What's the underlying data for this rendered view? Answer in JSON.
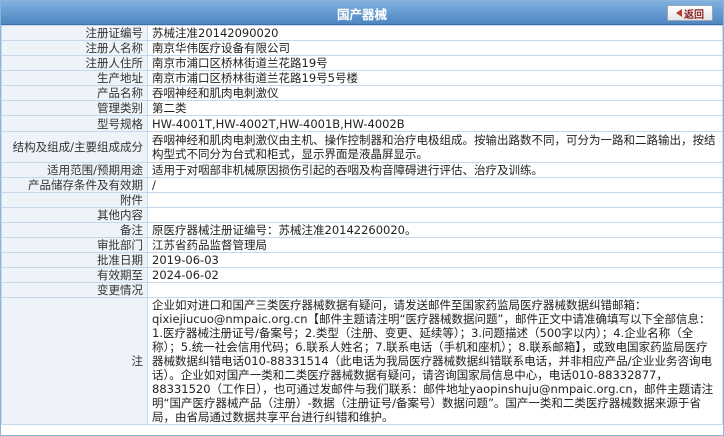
{
  "header": {
    "title": "国产器械",
    "back_label": "返回"
  },
  "rows": [
    {
      "label": "注册证编号",
      "value": "苏械注准20142090020"
    },
    {
      "label": "注册人名称",
      "value": "南京华伟医疗设备有限公司"
    },
    {
      "label": "注册人住所",
      "value": "南京市浦口区桥林街道兰花路19号"
    },
    {
      "label": "生产地址",
      "value": "南京市浦口区桥林街道兰花路19号5号楼"
    },
    {
      "label": "产品名称",
      "value": "吞咽神经和肌肉电刺激仪"
    },
    {
      "label": "管理类别",
      "value": "第二类"
    },
    {
      "label": "型号规格",
      "value": "HW-4001T,HW-4002T,HW-4001B,HW-4002B"
    },
    {
      "label": "结构及组成/主要组成成分",
      "value": "吞咽神经和肌肉电刺激仪由主机、操作控制器和治疗电极组成。按输出路数不同，可分为一路和二路输出，按结构型式不同分为台式和柜式，显示界面是液晶屏显示。"
    },
    {
      "label": "适用范围/预期用途",
      "value": "适用于对咽部非机械原因损伤引起的吞咽及构音障碍进行评估、治疗及训练。"
    },
    {
      "label": "产品储存条件及有效期",
      "value": "/"
    },
    {
      "label": "附件",
      "value": ""
    },
    {
      "label": "其他内容",
      "value": ""
    },
    {
      "label": "备注",
      "value": "原医疗器械注册证编号：苏械注准20142260020。"
    },
    {
      "label": "审批部门",
      "value": "江苏省药品监督管理局"
    },
    {
      "label": "批准日期",
      "value": "2019-06-03"
    },
    {
      "label": "有效期至",
      "value": "2024-06-02"
    },
    {
      "label": "变更情况",
      "value": ""
    }
  ],
  "note": {
    "label": "注",
    "text": "企业如对进口和国产三类医疗器械数据有疑问，请发送邮件至国家药监局医疗器械数据纠错邮箱：qixiejiucuo@nmpaic.org.cn【邮件主题请注明“医疗器械数据问题”，邮件正文中请准确填写以下全部信息：1.医疗器械注册证号/备案号；2.类型（注册、变更、延续等）；3.问题描述（500字以内）；4.企业名称（全称）；5.统一社会信用代码；6.联系人姓名；7.联系电话（手机和座机）；8.联系邮箱】，或致电国家药监局医疗器械数据纠错电话010-88331514（此电话为我局医疗器械数据纠错联系电话，并非相应产品/企业业务咨询电话）。企业如对国产一类和二类医疗器械数据有疑问，请咨询国家局信息中心，电话010-88332877，88331520（工作日），也可通过发邮件与我们联系：邮件地址yaopinshuju@nmpaic.org.cn，邮件主题请注明“国产医疗器械产品（注册）-数据（注册证号/备案号）数据问题”。国产一类和二类医疗器械数据来源于省局，由省局通过数据共享平台进行纠错和维护。"
  }
}
